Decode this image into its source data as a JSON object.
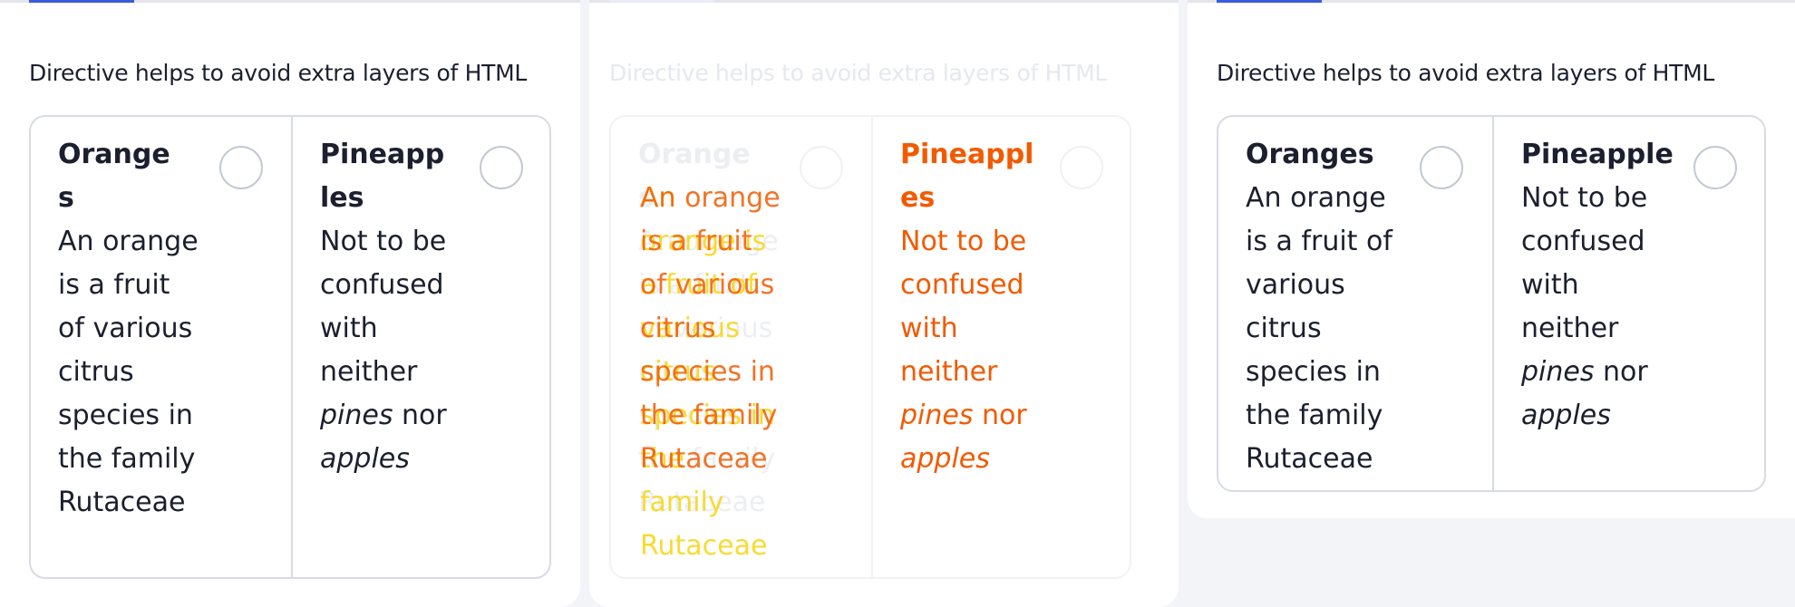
{
  "caption": "Directive helps to avoid extra layers of HTML",
  "cards": {
    "oranges": {
      "title": "Oranges",
      "text": "An orange is a fruit of various citrus species in the family Rutaceae"
    },
    "pineapples_title_wrapped": "Pineapples",
    "pineapple": {
      "title": "Pineapple",
      "text_prefix": "Not to be confused with neither",
      "italic_1": "pines",
      "mid": "nor",
      "italic_2": "apples"
    }
  },
  "colors": {
    "accent": "#3b5bdb",
    "animation_orange": "#f25a00",
    "animation_yellow": "#f7d81e",
    "border": "#d8dbe3"
  },
  "icons": [
    "radio-unchecked-icon"
  ]
}
